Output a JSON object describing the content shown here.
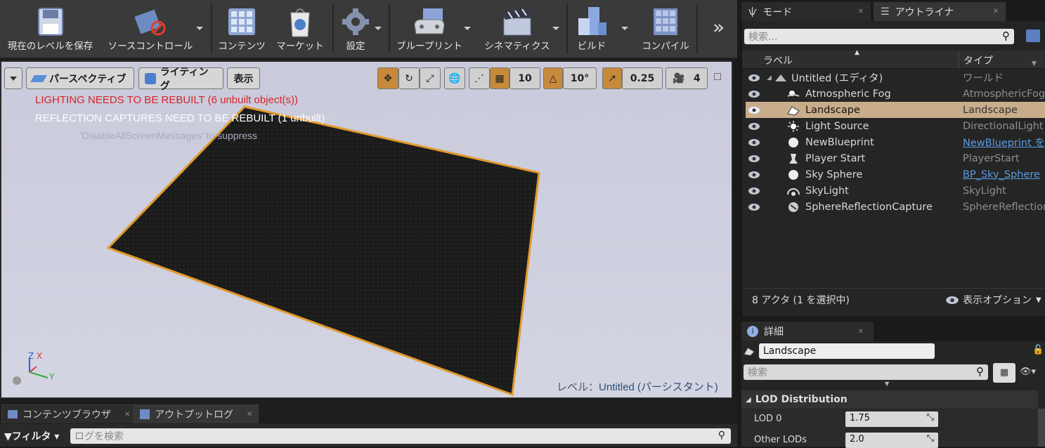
{
  "toolbar": {
    "buttons": [
      {
        "label": "現在のレベルを保存",
        "icon": "save-icon"
      },
      {
        "label": "ソースコントロール",
        "icon": "source-control-icon"
      },
      {
        "label": "コンテンツ",
        "icon": "content-icon"
      },
      {
        "label": "マーケット",
        "icon": "marketplace-icon"
      },
      {
        "label": "設定",
        "icon": "settings-icon"
      },
      {
        "label": "ブループリント",
        "icon": "blueprint-icon"
      },
      {
        "label": "シネマティクス",
        "icon": "cinematics-icon"
      },
      {
        "label": "ビルド",
        "icon": "build-icon"
      },
      {
        "label": "コンパイル",
        "icon": "compile-icon"
      }
    ],
    "more": "»"
  },
  "viewport": {
    "perspective": "パースペクティブ",
    "lighting": "ライティング",
    "show": "表示",
    "grid_snap": "10",
    "rotation_snap": "10°",
    "scale_snap": "0.25",
    "camera_speed": "4",
    "msg_lighting": "LIGHTING NEEDS TO BE REBUILT (6 unbuilt object(s))",
    "msg_reflection": "REFLECTION CAPTURES NEED TO BE REBUILT (1 unbuilt)",
    "msg_disable": "'DisableAllScreenMessages' to suppress",
    "level_label": "レベル：",
    "level_name": "Untitled (パーシスタント)",
    "axis_x": "X",
    "axis_y": "Y",
    "axis_z": "Z"
  },
  "bottom": {
    "tab_content": "コンテンツブラウザ",
    "tab_output": "アウトプットログ",
    "filter": "フィルタ",
    "search_placeholder": "ログを検索"
  },
  "right_tabs": {
    "modes": "モード",
    "outliner": "アウトライナ"
  },
  "outliner": {
    "search_placeholder": "検索...",
    "col_label": "ラベル",
    "col_type": "タイプ",
    "rows": [
      {
        "name": "Untitled (エディタ)",
        "type": "ワールド",
        "icon": "world-icon"
      },
      {
        "name": "Atmospheric Fog",
        "type": "AtmosphericFog",
        "icon": "fog-icon"
      },
      {
        "name": "Landscape",
        "type": "Landscape",
        "icon": "landscape-icon"
      },
      {
        "name": "Light Source",
        "type": "DirectionalLight",
        "icon": "sun-icon"
      },
      {
        "name": "NewBlueprint",
        "type": "NewBlueprint を",
        "icon": "sphere-icon"
      },
      {
        "name": "Player Start",
        "type": "PlayerStart",
        "icon": "player-start-icon"
      },
      {
        "name": "Sky Sphere",
        "type": "BP_Sky_Sphere",
        "icon": "sphere-icon"
      },
      {
        "name": "SkyLight",
        "type": "SkyLight",
        "icon": "skylight-icon"
      },
      {
        "name": "SphereReflectionCapture",
        "type": "SphereReflection",
        "icon": "reflection-icon"
      }
    ],
    "status": "8 アクタ (1 を選択中)",
    "view_options": "表示オプション"
  },
  "details": {
    "tab": "詳細",
    "object_name": "Landscape",
    "search_placeholder": "検索",
    "section": "LOD Distribution",
    "props": [
      {
        "label": "LOD 0",
        "value": "1.75"
      },
      {
        "label": "Other LODs",
        "value": "2.0"
      }
    ]
  },
  "colors": {
    "accent": "#c7893a",
    "selection": "#c9ad8b",
    "error": "#d8232a",
    "link": "#5a9be0"
  }
}
